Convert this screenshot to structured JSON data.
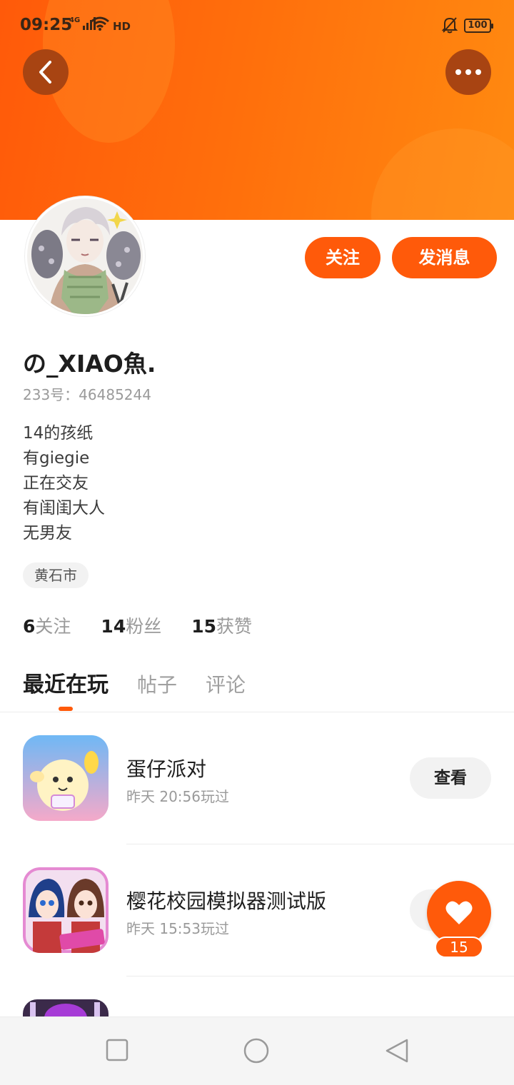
{
  "status_bar": {
    "time": "09:25",
    "network": "4G",
    "hd_label": "HD",
    "battery": "100"
  },
  "header": {
    "back_icon": "chevron-left-icon",
    "more_icon": "more-dots-icon",
    "banner_color": "#ff6a0c"
  },
  "profile": {
    "nickname": "の_XIAO魚.",
    "uid": "233号：46485244",
    "bio": [
      "14的孩纸",
      "有giegie",
      "正在交友",
      "有闺闺大人",
      "无男友"
    ],
    "location": "黄石市",
    "follow_button": "关注",
    "message_button": "发消息",
    "stats": [
      {
        "value": "6",
        "label": "关注"
      },
      {
        "value": "14",
        "label": "粉丝"
      },
      {
        "value": "15",
        "label": "获赞"
      }
    ]
  },
  "tabs": [
    {
      "label": "最近在玩",
      "active": true
    },
    {
      "label": "帖子",
      "active": false
    },
    {
      "label": "评论",
      "active": false
    }
  ],
  "games": [
    {
      "name": "蛋仔派对",
      "played": "昨天 20:56玩过",
      "action": "查看"
    },
    {
      "name": "樱花校园模拟器测试版",
      "played": "昨天 15:53玩过",
      "action": "查看"
    }
  ],
  "like_fab": {
    "icon": "heart-icon",
    "count": "15"
  },
  "colors": {
    "accent": "#ff5a0a"
  }
}
